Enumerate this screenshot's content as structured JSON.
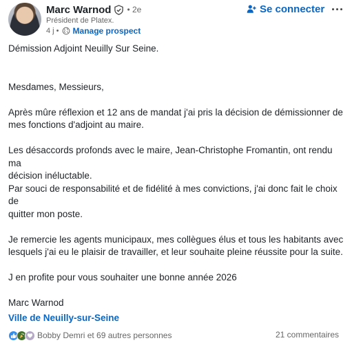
{
  "author": {
    "name": "Marc Warnod",
    "degree": "• 2e",
    "headline": "Président de Platex.",
    "time": "4 j •",
    "manage_label": "Manage prospect"
  },
  "actions": {
    "connect_label": "Se connecter",
    "more_icon": "ellipsis-icon"
  },
  "post": {
    "title": "Démission Adjoint Neuilly Sur Seine.",
    "greeting": "Mesdames, Messieurs,",
    "paragraphs": [
      "Après mûre réflexion et 12 ans de mandat j'ai pris la décision de démissionner de\nmes fonctions d'adjoint au maire.",
      "Les désaccords profonds avec le maire, Jean-Christophe Fromantin, ont rendu ma\ndécision inéluctable.\nPar souci de responsabilité et de fidélité à mes convictions, j'ai donc fait le choix de\nquitter mon poste.",
      "Je remercie les agents municipaux, mes collègues élus et tous les habitants avec\nlesquels j'ai eu le plaisir de travailler, et leur souhaite pleine réussite pour la suite.",
      "J en profite pour vous souhaiter une bonne année 2026"
    ],
    "signature": "Marc Warnod",
    "mention": "Ville de Neuilly-sur-Seine"
  },
  "social": {
    "reactions_text": "Bobby Demri et 69 autres personnes",
    "comments_text": "21 commentaires"
  },
  "colors": {
    "accent": "#0a66c2",
    "text": "#1d2226",
    "muted": "#666666"
  }
}
